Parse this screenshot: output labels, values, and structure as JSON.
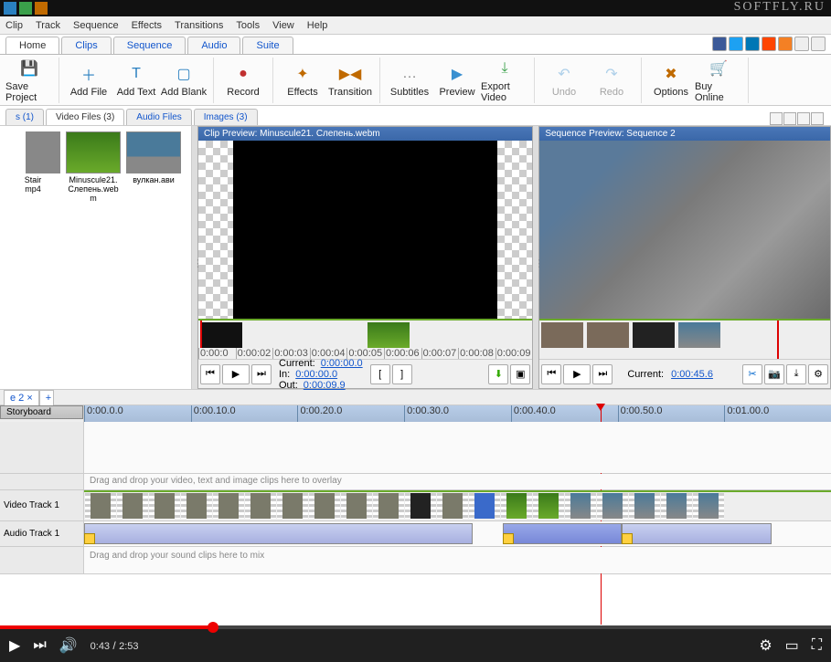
{
  "watermark": "SOFTFLY.RU",
  "menu": [
    "Clip",
    "Track",
    "Sequence",
    "Effects",
    "Transitions",
    "Tools",
    "View",
    "Help"
  ],
  "tabbar": [
    "Home",
    "Clips",
    "Sequence",
    "Audio",
    "Suite"
  ],
  "ribbon": [
    {
      "label": "Save Project",
      "color": "#3aa04a",
      "glyph": "💾"
    },
    {
      "label": "Add File",
      "color": "#2a80c0",
      "glyph": "＋"
    },
    {
      "label": "Add Text",
      "color": "#2a80c0",
      "glyph": "T"
    },
    {
      "label": "Add Blank",
      "color": "#2a80c0",
      "glyph": "▢"
    },
    {
      "label": "Record",
      "color": "#c03030",
      "glyph": "●"
    },
    {
      "label": "Effects",
      "color": "#c06a00",
      "glyph": "✦"
    },
    {
      "label": "Transition",
      "color": "#c06a00",
      "glyph": "▶◀"
    },
    {
      "label": "Subtitles",
      "color": "#888",
      "glyph": "…"
    },
    {
      "label": "Preview",
      "color": "#3a90d0",
      "glyph": "▶"
    },
    {
      "label": "Export Video",
      "color": "#3aa04a",
      "glyph": "⤓"
    },
    {
      "label": "Undo",
      "color": "#3a90d0",
      "glyph": "↶",
      "disabled": true
    },
    {
      "label": "Redo",
      "color": "#3a90d0",
      "glyph": "↷",
      "disabled": true
    },
    {
      "label": "Options",
      "color": "#c06a00",
      "glyph": "✖"
    },
    {
      "label": "Buy Online",
      "color": "#3aa04a",
      "glyph": "🛒"
    }
  ],
  "mediaTabs": {
    "a": "s (1)",
    "b": "Video Files (3)",
    "c": "Audio Files",
    "d": "Images (3)"
  },
  "mediaItems": [
    {
      "label": "Stair\nmp4",
      "cls": "partial"
    },
    {
      "label": "Minuscule21.\nСлепень.webm",
      "cls": "grass"
    },
    {
      "label": "вулкан.ави",
      "cls": "sky"
    }
  ],
  "clipPreview": {
    "title": "Clip Preview: Minuscule21. Слепень.webm",
    "ruler": [
      "0:00:0",
      "0:00:02",
      "0:00:03",
      "0:00:04",
      "0:00:05",
      "0:00:06",
      "0:00:07",
      "0:00:08",
      "0:00:09"
    ],
    "times": {
      "currentLbl": "Current:",
      "currentVal": "0:00:00.0",
      "inLbl": "In:",
      "inVal": "0:00:00.0",
      "outLbl": "Out:",
      "outVal": "0:00:09.9"
    }
  },
  "seqPreview": {
    "title": "Sequence Preview: Sequence 2",
    "currentLbl": "Current:",
    "currentVal": "0:00:45.6"
  },
  "seqTab": "e 2 ×",
  "storyboard": "Storyboard",
  "ruler": [
    "0:00.0.0",
    "0:00.10.0",
    "0:00.20.0",
    "0:00.30.0",
    "0:00.40.0",
    "0:00.50.0",
    "0:01.00.0"
  ],
  "overlayHint": "Drag and drop your video, text and image clips here to overlay",
  "videoTrackLbl": "Video Track 1",
  "audioTrackLbl": "Audio Track 1",
  "mixHint": "Drag and drop your sound clips here to mix",
  "player": {
    "current": "0:43",
    "duration": "2:53"
  }
}
